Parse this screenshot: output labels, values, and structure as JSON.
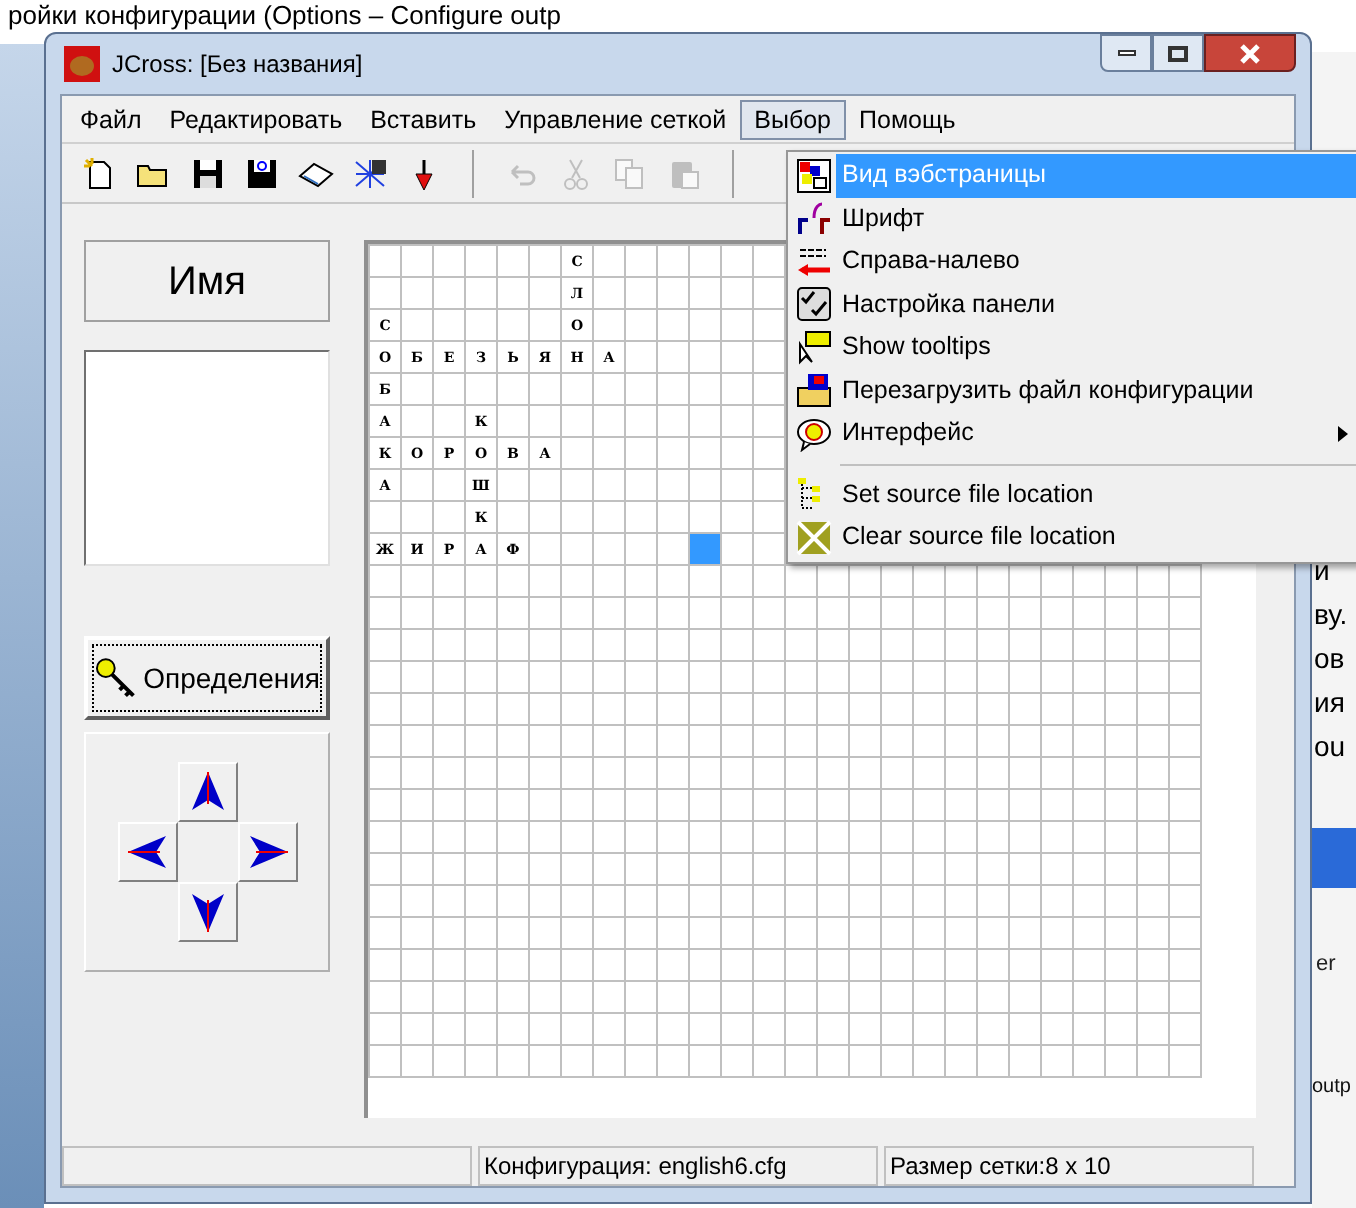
{
  "background": {
    "heading": "ройки конфигурации (Options – Configure outp",
    "side_fragments": [
      "и",
      "ву.",
      "ов",
      "ия",
      "ou"
    ],
    "side_tab": "er",
    "side_bottom": "outp"
  },
  "window": {
    "title": "JCross: [Без названия]"
  },
  "menu_bar": [
    {
      "label": "Файл",
      "selected": false
    },
    {
      "label": "Редактировать",
      "selected": false
    },
    {
      "label": "Вставить",
      "selected": false
    },
    {
      "label": "Управление сеткой",
      "selected": false
    },
    {
      "label": "Выбор",
      "selected": true
    },
    {
      "label": "Помощь",
      "selected": false
    }
  ],
  "toolbar": [
    {
      "kind": "tool",
      "disabled": false
    },
    {
      "kind": "tool",
      "disabled": false
    },
    {
      "kind": "tool",
      "disabled": false
    },
    {
      "kind": "tool",
      "disabled": false
    },
    {
      "kind": "tool",
      "disabled": false
    },
    {
      "kind": "tool",
      "disabled": false
    },
    {
      "kind": "tool",
      "disabled": false
    },
    {
      "kind": "separator"
    },
    {
      "kind": "tool",
      "disabled": true
    },
    {
      "kind": "tool",
      "disabled": true
    },
    {
      "kind": "tool",
      "disabled": true
    },
    {
      "kind": "tool",
      "disabled": true
    }
  ],
  "left_panel": {
    "name_label": "Имя",
    "definitions_button": "Определения"
  },
  "grid": {
    "rows": [
      [
        {
          "selected": false
        },
        {
          "selected": false
        },
        {
          "selected": false
        },
        {
          "selected": false
        },
        {
          "selected": false
        },
        {
          "selected": false
        },
        {
          "letter": "С",
          "selected": false
        }
      ],
      [
        {
          "selected": false
        },
        {
          "selected": false
        },
        {
          "selected": false
        },
        {
          "selected": false
        },
        {
          "selected": false
        },
        {
          "selected": false
        },
        {
          "letter": "Л",
          "selected": false
        }
      ],
      [
        {
          "letter": "С",
          "selected": false
        },
        {
          "selected": false
        },
        {
          "selected": false
        },
        {
          "selected": false
        },
        {
          "selected": false
        },
        {
          "selected": false
        },
        {
          "letter": "О",
          "selected": false
        }
      ],
      [
        {
          "letter": "О",
          "selected": false
        },
        {
          "letter": "Б",
          "selected": false
        },
        {
          "letter": "Е",
          "selected": false
        },
        {
          "letter": "З",
          "selected": false
        },
        {
          "letter": "Ь",
          "selected": false
        },
        {
          "letter": "Я",
          "selected": false
        },
        {
          "letter": "Н",
          "selected": false
        },
        {
          "letter": "А",
          "selected": false
        }
      ],
      [
        {
          "letter": "Б",
          "selected": false
        }
      ],
      [
        {
          "letter": "А",
          "selected": false
        },
        {
          "selected": false
        },
        {
          "selected": false
        },
        {
          "letter": "К",
          "selected": false
        }
      ],
      [
        {
          "letter": "К",
          "selected": false
        },
        {
          "letter": "О",
          "selected": false
        },
        {
          "letter": "Р",
          "selected": false
        },
        {
          "letter": "О",
          "selected": false
        },
        {
          "letter": "В",
          "selected": false
        },
        {
          "letter": "А",
          "selected": false
        }
      ],
      [
        {
          "letter": "А",
          "selected": false
        },
        {
          "selected": false
        },
        {
          "selected": false
        },
        {
          "letter": "Ш",
          "selected": false
        }
      ],
      [
        {
          "selected": false
        },
        {
          "selected": false
        },
        {
          "selected": false
        },
        {
          "letter": "К",
          "selected": false
        }
      ],
      [
        {
          "letter": "Ж",
          "selected": false
        },
        {
          "letter": "И",
          "selected": false
        },
        {
          "letter": "Р",
          "selected": false
        },
        {
          "letter": "А",
          "selected": false
        },
        {
          "letter": "Ф",
          "selected": false
        },
        {
          "selected": false
        },
        {
          "selected": false
        },
        {
          "selected": false
        },
        {
          "selected": false
        },
        {
          "selected": false
        },
        {
          "selected": true
        }
      ]
    ]
  },
  "dropdown_menu": [
    {
      "kind": "item",
      "label": "Вид вэбстраницы",
      "selected": true,
      "has_submenu": false
    },
    {
      "kind": "item",
      "label": "Шрифт",
      "selected": false,
      "has_submenu": false
    },
    {
      "kind": "item",
      "label": "Справа-налево",
      "selected": false,
      "has_submenu": false
    },
    {
      "kind": "item",
      "label": "Настройка панели",
      "selected": false,
      "has_submenu": false
    },
    {
      "kind": "item",
      "label": "Show tooltips",
      "selected": false,
      "has_submenu": false
    },
    {
      "kind": "item",
      "label": "Перезагрузить файл конфигурации",
      "selected": false,
      "has_submenu": false
    },
    {
      "kind": "item",
      "label": "Интерфейс",
      "selected": false,
      "has_submenu": true
    },
    {
      "kind": "separator"
    },
    {
      "kind": "item",
      "label": "Set source file location",
      "selected": false,
      "has_submenu": false
    },
    {
      "kind": "item",
      "label": "Clear source file location",
      "selected": false,
      "has_submenu": false
    }
  ],
  "status_bar": [
    "Конфигурация: english6.cfg",
    "Размер сетки:8 x 10"
  ]
}
